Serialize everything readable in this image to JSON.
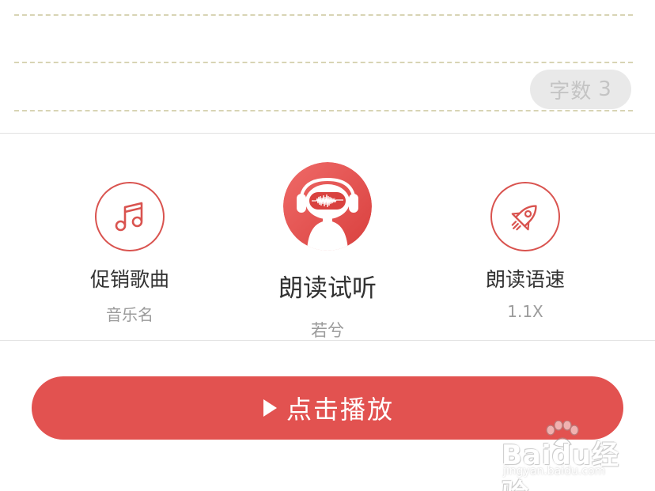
{
  "editor": {
    "char_count_label": "字数",
    "char_count_value": "3"
  },
  "options": {
    "music": {
      "title": "促销歌曲",
      "subtitle": "音乐名",
      "icon": "music-note-icon"
    },
    "voice": {
      "title": "朗读试听",
      "subtitle": "若兮",
      "icon": "robot-headphones-icon"
    },
    "speed": {
      "title": "朗读语速",
      "subtitle": "1.1X",
      "icon": "rocket-icon"
    }
  },
  "play_button": {
    "label": "点击播放",
    "icon": "play-icon"
  },
  "watermark": {
    "logo_text": "Baidu经验",
    "url": "jingyan.baidu.com"
  },
  "colors": {
    "accent": "#e25250",
    "ring": "#d9534f",
    "dash": "#d8d4b4",
    "badge_bg": "#e9e9e9",
    "badge_text": "#c4c4c4"
  }
}
